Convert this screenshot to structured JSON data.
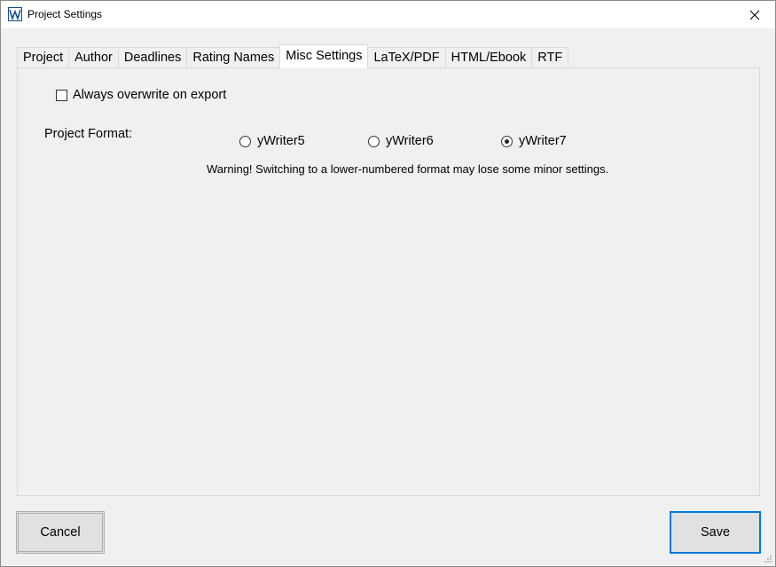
{
  "window": {
    "title": "Project Settings"
  },
  "tabs": [
    {
      "label": "Project"
    },
    {
      "label": "Author"
    },
    {
      "label": "Deadlines"
    },
    {
      "label": "Rating Names"
    },
    {
      "label": "Misc Settings"
    },
    {
      "label": "LaTeX/PDF"
    },
    {
      "label": "HTML/Ebook"
    },
    {
      "label": "RTF"
    }
  ],
  "active_tab": "Misc Settings",
  "misc": {
    "overwrite_label": "Always overwrite on export",
    "overwrite_checked": false,
    "format_label": "Project Format:",
    "formats": [
      {
        "label": "yWriter5",
        "checked": false
      },
      {
        "label": "yWriter6",
        "checked": false
      },
      {
        "label": "yWriter7",
        "checked": true
      }
    ],
    "warning": "Warning! Switching to a lower-numbered format may lose some minor settings."
  },
  "buttons": {
    "cancel": "Cancel",
    "save": "Save"
  },
  "colors": {
    "accent": "#0078d7",
    "background": "#f0f0f0"
  }
}
